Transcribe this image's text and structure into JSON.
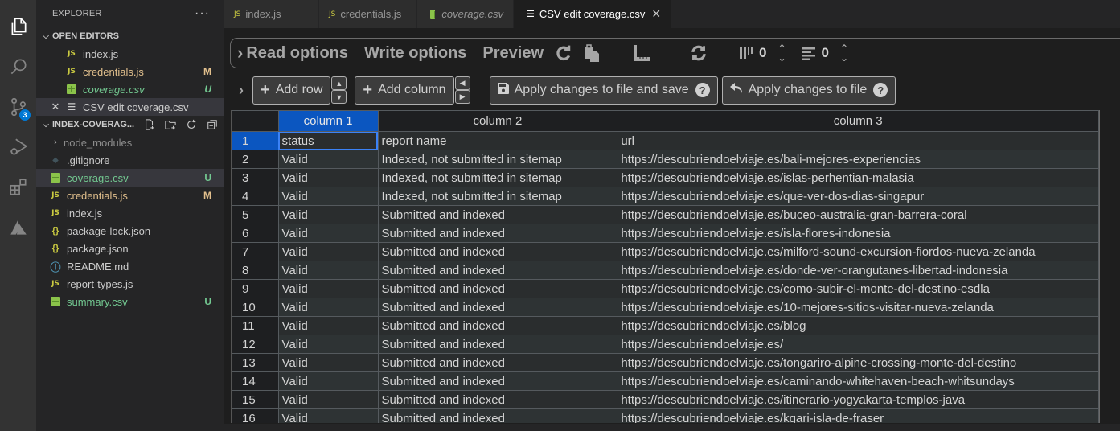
{
  "activity_bar": {
    "items": [
      {
        "name": "explorer",
        "active": true
      },
      {
        "name": "search"
      },
      {
        "name": "source-control",
        "badge": "3"
      },
      {
        "name": "run-debug"
      },
      {
        "name": "extensions"
      },
      {
        "name": "azure"
      }
    ]
  },
  "sidebar": {
    "title": "EXPLORER",
    "more_label": "···",
    "open_editors": {
      "header": "OPEN EDITORS",
      "items": [
        {
          "label": "index.js",
          "type": "js",
          "status": ""
        },
        {
          "label": "credentials.js",
          "type": "js",
          "status": "M"
        },
        {
          "label": "coverage.csv",
          "type": "csv",
          "status": "U"
        },
        {
          "label": "CSV edit coverage.csv",
          "type": "preview",
          "status": ""
        }
      ]
    },
    "workspace": {
      "header": "INDEX-COVERAG...",
      "items": [
        {
          "label": "node_modules",
          "type": "folder",
          "status": ""
        },
        {
          "label": ".gitignore",
          "type": "git",
          "status": ""
        },
        {
          "label": "coverage.csv",
          "type": "csv",
          "status": "U"
        },
        {
          "label": "credentials.js",
          "type": "js",
          "status": "M"
        },
        {
          "label": "index.js",
          "type": "js",
          "status": ""
        },
        {
          "label": "package-lock.json",
          "type": "json",
          "status": ""
        },
        {
          "label": "package.json",
          "type": "json",
          "status": ""
        },
        {
          "label": "README.md",
          "type": "info",
          "status": ""
        },
        {
          "label": "report-types.js",
          "type": "js",
          "status": ""
        },
        {
          "label": "summary.csv",
          "type": "csv",
          "status": "U"
        }
      ]
    }
  },
  "tabs": [
    {
      "label": "index.js",
      "type": "js"
    },
    {
      "label": "credentials.js",
      "type": "js"
    },
    {
      "label": "coverage.csv",
      "type": "csv"
    },
    {
      "label": "CSV edit coverage.csv",
      "type": "preview",
      "active": true
    }
  ],
  "csv_editor": {
    "options": {
      "read": "Read options",
      "write": "Write options",
      "preview": "Preview",
      "fixed_columns": "0",
      "fixed_rows": "0"
    },
    "buttons": {
      "add_row": "Add row",
      "add_column": "Add column",
      "apply_save": "Apply changes to file and save",
      "apply": "Apply changes to file",
      "help": "?"
    },
    "columns": [
      "column 1",
      "column 2",
      "column 3"
    ],
    "rows": [
      [
        "1",
        "status",
        "report name",
        "url"
      ],
      [
        "2",
        "Valid",
        "Indexed, not submitted in sitemap",
        "https://descubriendoelviaje.es/bali-mejores-experiencias"
      ],
      [
        "3",
        "Valid",
        "Indexed, not submitted in sitemap",
        "https://descubriendoelviaje.es/islas-perhentian-malasia"
      ],
      [
        "4",
        "Valid",
        "Indexed, not submitted in sitemap",
        "https://descubriendoelviaje.es/que-ver-dos-dias-singapur"
      ],
      [
        "5",
        "Valid",
        "Submitted and indexed",
        "https://descubriendoelviaje.es/buceo-australia-gran-barrera-coral"
      ],
      [
        "6",
        "Valid",
        "Submitted and indexed",
        "https://descubriendoelviaje.es/isla-flores-indonesia"
      ],
      [
        "7",
        "Valid",
        "Submitted and indexed",
        "https://descubriendoelviaje.es/milford-sound-excursion-fiordos-nueva-zelanda"
      ],
      [
        "8",
        "Valid",
        "Submitted and indexed",
        "https://descubriendoelviaje.es/donde-ver-orangutanes-libertad-indonesia"
      ],
      [
        "9",
        "Valid",
        "Submitted and indexed",
        "https://descubriendoelviaje.es/como-subir-el-monte-del-destino-esdla"
      ],
      [
        "10",
        "Valid",
        "Submitted and indexed",
        "https://descubriendoelviaje.es/10-mejores-sitios-visitar-nueva-zelanda"
      ],
      [
        "11",
        "Valid",
        "Submitted and indexed",
        "https://descubriendoelviaje.es/blog"
      ],
      [
        "12",
        "Valid",
        "Submitted and indexed",
        "https://descubriendoelviaje.es/"
      ],
      [
        "13",
        "Valid",
        "Submitted and indexed",
        "https://descubriendoelviaje.es/tongariro-alpine-crossing-monte-del-destino"
      ],
      [
        "14",
        "Valid",
        "Submitted and indexed",
        "https://descubriendoelviaje.es/caminando-whitehaven-beach-whitsundays"
      ],
      [
        "15",
        "Valid",
        "Submitted and indexed",
        "https://descubriendoelviaje.es/itinerario-yogyakarta-templos-java"
      ],
      [
        "16",
        "Valid",
        "Submitted and indexed",
        "https://descubriendoelviaje.es/kgari-isla-de-fraser"
      ]
    ]
  }
}
